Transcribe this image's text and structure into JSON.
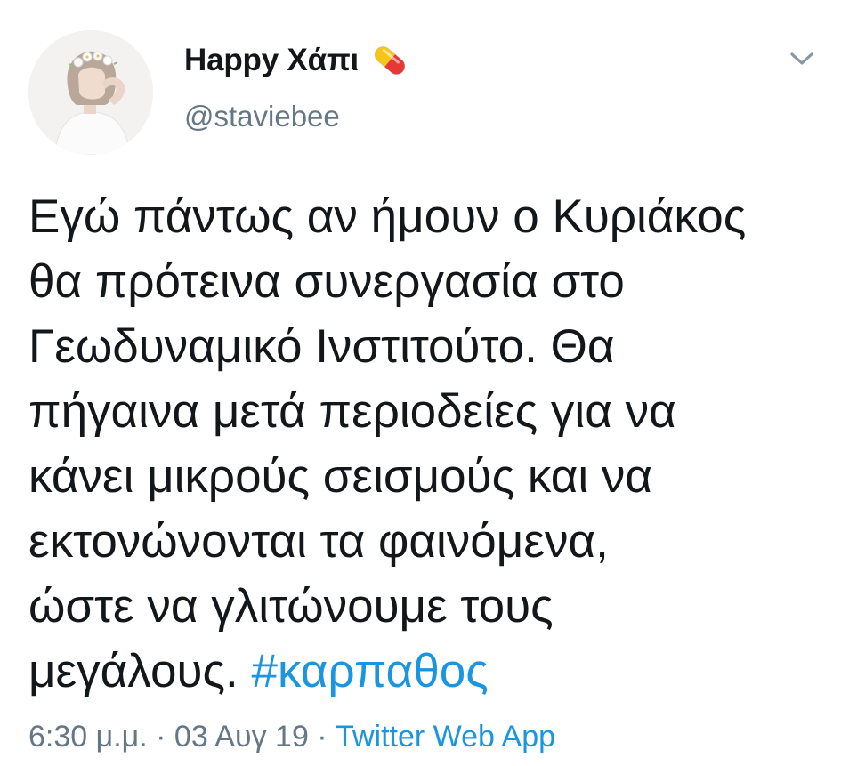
{
  "user": {
    "display_name": "Happy Χάπι",
    "emoji_icon": "pill-icon",
    "handle": "@staviebee",
    "avatar": "avatar"
  },
  "tweet": {
    "lines": [
      "Εγώ πάντως αν ήμουν ο Κυριάκος",
      "θα πρότεινα συνεργασία στο",
      "Γεωδυναμικό Ινστιτούτο. Θα",
      "πήγαινα μετά περιοδείες για να",
      "κάνει μικρούς σεισμούς και να",
      "εκτονώνονται τα φαινόμενα,",
      "ώστε να γλιτώνουμε τους"
    ],
    "last_line_text": "μεγάλους.",
    "hashtag": "#καρπαθος"
  },
  "meta": {
    "time": "6:30 μ.μ.",
    "separator1": " · ",
    "date": "03 Αυγ 19",
    "separator2": " · ",
    "source": "Twitter Web App"
  },
  "menu": {
    "caret_icon": "chevron-down-icon"
  },
  "colors": {
    "text": "#14171a",
    "secondary": "#657786",
    "link": "#1b95e0"
  }
}
